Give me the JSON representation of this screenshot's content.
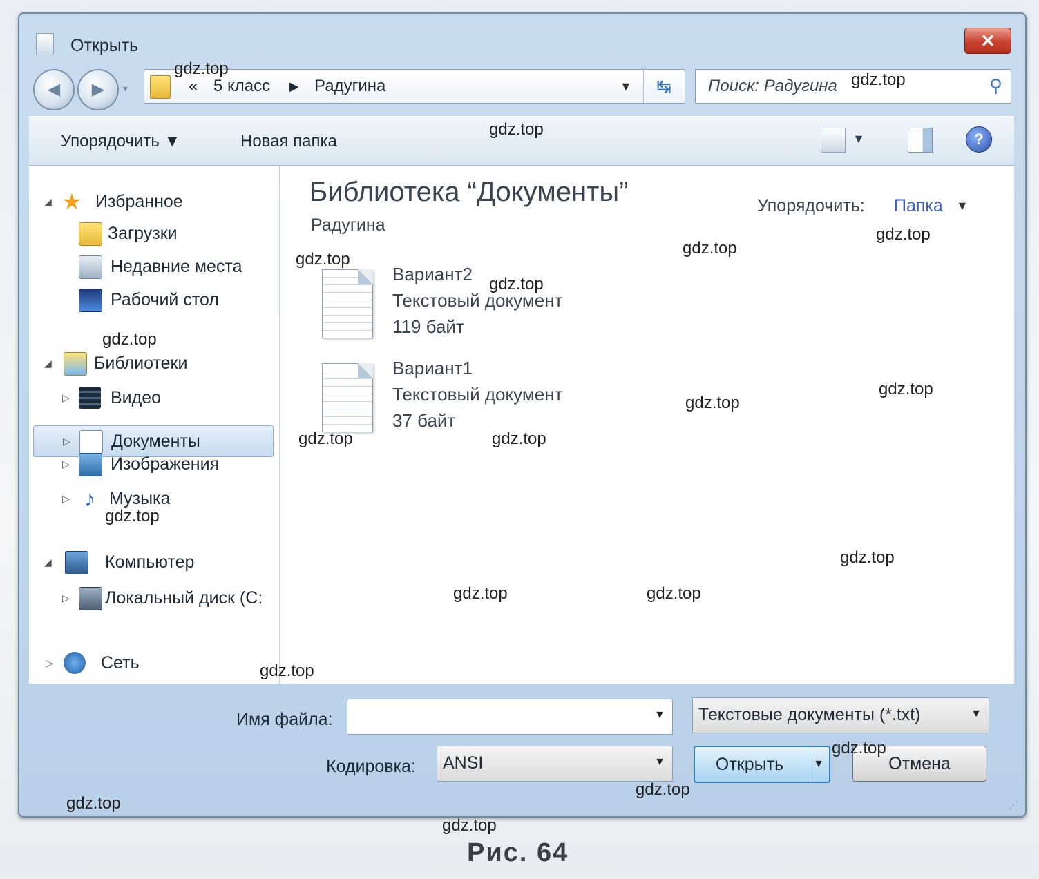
{
  "window": {
    "title": "Открыть",
    "close_glyph": "✕"
  },
  "navigation": {
    "back_glyph": "◀",
    "forward_glyph": "▶",
    "history_glyph": "▾"
  },
  "address": {
    "chevron": "«",
    "crumbs": [
      "5 класс",
      "Радугина"
    ],
    "separator": "▶",
    "dropdown_glyph": "▼",
    "refresh_glyph": "↹"
  },
  "search": {
    "placeholder": "Поиск: Радугина",
    "icon_glyph": "⚲"
  },
  "toolbar": {
    "organize": "Упорядочить ▼",
    "new_folder": "Новая папка",
    "views_drop": "▼",
    "help": "?"
  },
  "sidebar": {
    "favorites": {
      "label": "Избранное",
      "arrow": "◢",
      "icon": "★"
    },
    "favorite_items": [
      "Загрузки",
      "Недавние места",
      "Рабочий стол"
    ],
    "libraries": {
      "label": "Библиотеки",
      "arrow": "◢"
    },
    "library_items": [
      {
        "label": "Видео",
        "arrow": "▷"
      },
      {
        "label": "Документы",
        "arrow": "▷"
      },
      {
        "label": "Изображения",
        "arrow": "▷"
      },
      {
        "label": "Музыка",
        "arrow": "▷",
        "icon": "♪"
      }
    ],
    "computer": {
      "label": "Компьютер",
      "arrow": "◢"
    },
    "computer_items": [
      {
        "label": "Локальный диск (C:",
        "arrow": "▷"
      }
    ],
    "network": {
      "label": "Сеть",
      "arrow": "▷"
    }
  },
  "content": {
    "library_title": "Библиотека “Документы”",
    "library_subtitle": "Радугина",
    "arrange_label": "Упорядочить:",
    "arrange_value": "Папка",
    "arrange_drop": "▼",
    "files": [
      {
        "name": "Вариант2",
        "type": "Текстовый документ",
        "size": "119 байт"
      },
      {
        "name": "Вариант1",
        "type": "Текстовый документ",
        "size": "37 байт"
      }
    ]
  },
  "bottom": {
    "filename_label": "Имя файла:",
    "filename_value": "",
    "filename_drop": "▼",
    "filetype_value": "Текстовые документы (*.txt)",
    "filetype_drop": "▼",
    "encoding_label": "Кодировка:",
    "encoding_value": "ANSI",
    "encoding_drop": "▼",
    "open_label": "Открыть",
    "open_split": "▼",
    "cancel_label": "Отмена",
    "grip": "⋰"
  },
  "watermark": "gdz.top",
  "caption": "Рис.  64"
}
